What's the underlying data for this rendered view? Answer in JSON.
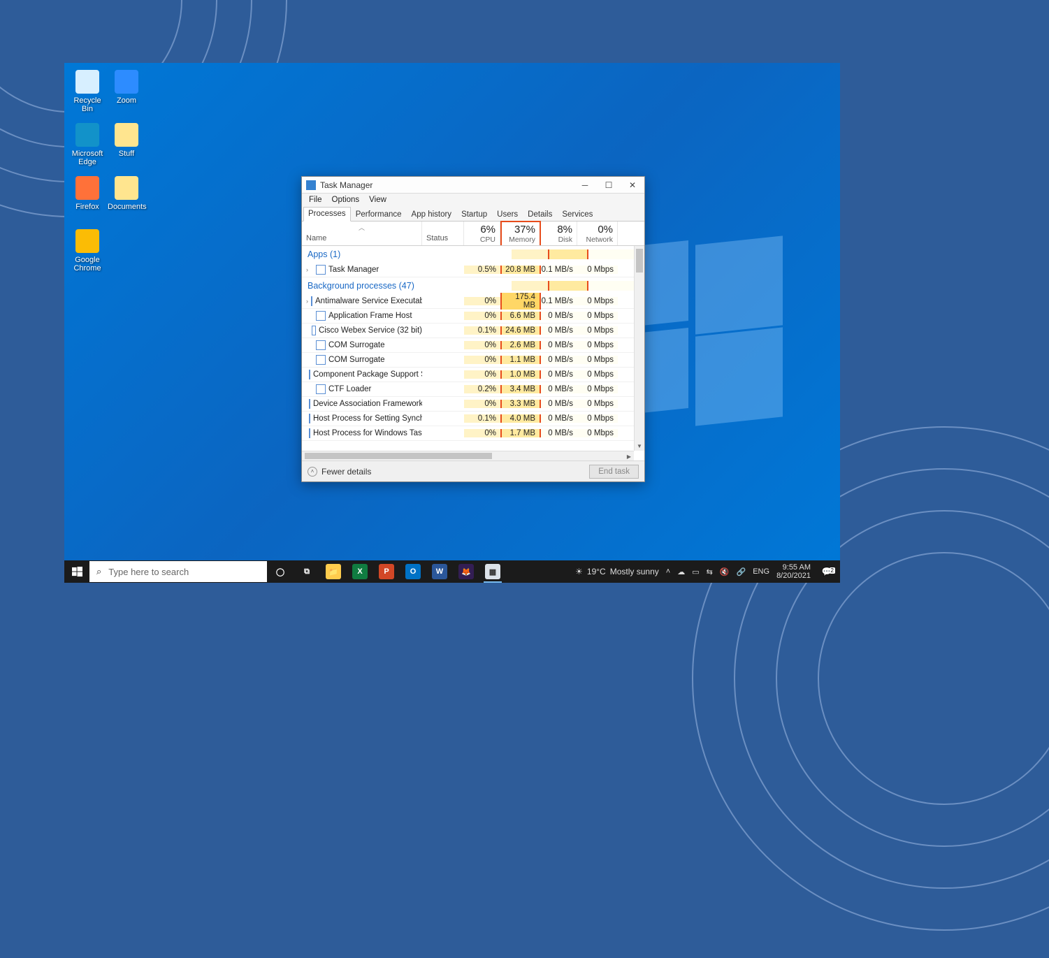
{
  "desktop_icons": [
    {
      "label": "Recycle Bin",
      "color": "#d7efff"
    },
    {
      "label": "Zoom",
      "color": "#2d8cff"
    },
    {
      "label": "Microsoft Edge",
      "color": "#1292c9"
    },
    {
      "label": "Stuff",
      "color": "#ffe58f"
    },
    {
      "label": "Firefox",
      "color": "#ff7139"
    },
    {
      "label": "Documents",
      "color": "#ffe58f"
    },
    {
      "label": "Google Chrome",
      "color": "#fbbc05"
    }
  ],
  "tm": {
    "title": "Task Manager",
    "menu": [
      "File",
      "Options",
      "View"
    ],
    "tabs": [
      "Processes",
      "Performance",
      "App history",
      "Startup",
      "Users",
      "Details",
      "Services"
    ],
    "cols": {
      "name": "Name",
      "status": "Status",
      "cpu": {
        "pct": "6%",
        "label": "CPU"
      },
      "memory": {
        "pct": "37%",
        "label": "Memory"
      },
      "disk": {
        "pct": "8%",
        "label": "Disk"
      },
      "network": {
        "pct": "0%",
        "label": "Network"
      }
    },
    "groups": {
      "apps": "Apps (1)",
      "bg": "Background processes (47)"
    },
    "apps": [
      {
        "name": "Task Manager",
        "cpu": "0.5%",
        "mem": "20.8 MB",
        "disk": "0.1 MB/s",
        "net": "0 Mbps",
        "exp": true
      }
    ],
    "bg": [
      {
        "name": "Antimalware Service Executable",
        "cpu": "0%",
        "mem": "175.4 MB",
        "disk": "0.1 MB/s",
        "net": "0 Mbps",
        "exp": true,
        "hi": true
      },
      {
        "name": "Application Frame Host",
        "cpu": "0%",
        "mem": "6.6 MB",
        "disk": "0 MB/s",
        "net": "0 Mbps"
      },
      {
        "name": "Cisco Webex Service (32 bit)",
        "cpu": "0.1%",
        "mem": "24.6 MB",
        "disk": "0 MB/s",
        "net": "0 Mbps"
      },
      {
        "name": "COM Surrogate",
        "cpu": "0%",
        "mem": "2.6 MB",
        "disk": "0 MB/s",
        "net": "0 Mbps"
      },
      {
        "name": "COM Surrogate",
        "cpu": "0%",
        "mem": "1.1 MB",
        "disk": "0 MB/s",
        "net": "0 Mbps"
      },
      {
        "name": "Component Package Support S...",
        "cpu": "0%",
        "mem": "1.0 MB",
        "disk": "0 MB/s",
        "net": "0 Mbps"
      },
      {
        "name": "CTF Loader",
        "cpu": "0.2%",
        "mem": "3.4 MB",
        "disk": "0 MB/s",
        "net": "0 Mbps"
      },
      {
        "name": "Device Association Framework ...",
        "cpu": "0%",
        "mem": "3.3 MB",
        "disk": "0 MB/s",
        "net": "0 Mbps"
      },
      {
        "name": "Host Process for Setting Synchr...",
        "cpu": "0.1%",
        "mem": "4.0 MB",
        "disk": "0 MB/s",
        "net": "0 Mbps"
      },
      {
        "name": "Host Process for Windows Tasks",
        "cpu": "0%",
        "mem": "1.7 MB",
        "disk": "0 MB/s",
        "net": "0 Mbps"
      }
    ],
    "footer": {
      "fewer": "Fewer details",
      "end": "End task"
    }
  },
  "taskbar": {
    "search_placeholder": "Type here to search",
    "apps": [
      {
        "name": "cortana",
        "glyph": "◯",
        "bg": "transparent",
        "fg": "#fff"
      },
      {
        "name": "task-view",
        "glyph": "⧉",
        "bg": "transparent",
        "fg": "#fff"
      },
      {
        "name": "file-explorer",
        "glyph": "📁",
        "bg": "#ffcc4d",
        "fg": "#000"
      },
      {
        "name": "excel",
        "glyph": "X",
        "bg": "#107c41",
        "fg": "#fff"
      },
      {
        "name": "powerpoint",
        "glyph": "P",
        "bg": "#d24726",
        "fg": "#fff"
      },
      {
        "name": "outlook",
        "glyph": "O",
        "bg": "#0072c6",
        "fg": "#fff"
      },
      {
        "name": "word",
        "glyph": "W",
        "bg": "#2b579a",
        "fg": "#fff"
      },
      {
        "name": "firefox",
        "glyph": "🦊",
        "bg": "#331e54",
        "fg": "#fff"
      },
      {
        "name": "task-manager",
        "glyph": "▦",
        "bg": "#dce3ea",
        "fg": "#333",
        "running": true
      }
    ],
    "weather": {
      "temp": "19°C",
      "desc": "Mostly sunny"
    },
    "sys_icons": [
      "˄",
      "☁",
      "▭",
      "⇆",
      "🔇",
      "🔗"
    ],
    "lang": "ENG",
    "time": "9:55 AM",
    "date": "8/20/2021",
    "notif_count": "2"
  }
}
